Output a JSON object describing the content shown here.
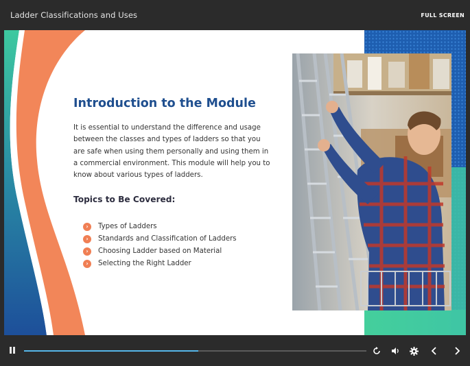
{
  "player": {
    "title": "Ladder Classifications and Uses",
    "fullscreen_label": "FULL SCREEN",
    "progress_fraction": 0.51,
    "controls": [
      "pause-icon",
      "replay-icon",
      "volume-icon",
      "settings-icon",
      "previous-icon",
      "next-icon"
    ]
  },
  "slide": {
    "heading": "Introduction to the Module",
    "intro": "It is essential to understand the difference and usage between the classes and types of ladders so that you are safe when using them personally and using them in a commercial environment. This module will help you to know about various types of ladders.",
    "topics_heading": "Topics to Be Covered:",
    "topics": [
      "Types of Ladders",
      "Standards and Classification of Ladders",
      "Choosing Ladder based on Material",
      "Selecting the Right Ladder"
    ],
    "bullet_icon": "chevron-right-icon"
  },
  "colors": {
    "heading": "#1f4f8f",
    "accent_orange": "#f07f54",
    "accent_teal": "#3cc7a0",
    "accent_blue": "#1c5ba8",
    "progress": "#56b7ea"
  }
}
